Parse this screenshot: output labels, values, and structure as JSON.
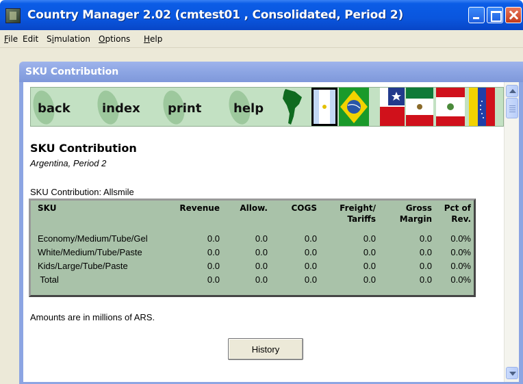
{
  "window": {
    "title": "Country Manager 2.02 (cmtest01 , Consolidated, Period 2)",
    "icons": {
      "app": "app-icon",
      "minimize": "minimize-icon",
      "maximize": "maximize-icon",
      "close": "close-icon"
    }
  },
  "menu": {
    "items": [
      {
        "mnemonic": "F",
        "rest": "ile"
      },
      {
        "mnemonic": "",
        "rest": "Edit"
      },
      {
        "pre": "S",
        "mnemonic": "i",
        "rest": "mulation"
      },
      {
        "mnemonic": "O",
        "rest": "ptions"
      },
      {
        "mnemonic": "H",
        "rest": "elp"
      }
    ]
  },
  "inner_window": {
    "title": "SKU Contribution"
  },
  "nav": {
    "buttons": [
      "back",
      "index",
      "print",
      "help"
    ],
    "flags": [
      "south-america-map-icon",
      "argentina-flag-icon",
      "brazil-flag-icon",
      "chile-flag-icon",
      "mexico-flag-icon",
      "peru-flag-icon",
      "venezuela-flag-icon"
    ]
  },
  "page": {
    "title": "SKU Contribution",
    "subtitle": "Argentina, Period 2",
    "table_caption": "SKU Contribution: Allsmile",
    "footnote": "Amounts are in millions of ARS.",
    "history_label": "History"
  },
  "table": {
    "headers": [
      {
        "l1": "SKU",
        "l2": ""
      },
      {
        "l1": "Revenue",
        "l2": ""
      },
      {
        "l1": "Allow.",
        "l2": ""
      },
      {
        "l1": "COGS",
        "l2": ""
      },
      {
        "l1": "Freight/",
        "l2": "Tariffs"
      },
      {
        "l1": "Gross",
        "l2": "Margin"
      },
      {
        "l1": "Pct of",
        "l2": "Rev."
      }
    ],
    "rows": [
      [
        "Economy/Medium/Tube/Gel",
        "0.0",
        "0.0",
        "0.0",
        "0.0",
        "0.0",
        "0.0%"
      ],
      [
        "White/Medium/Tube/Paste",
        "0.0",
        "0.0",
        "0.0",
        "0.0",
        "0.0",
        "0.0%"
      ],
      [
        "Kids/Large/Tube/Paste",
        "0.0",
        "0.0",
        "0.0",
        "0.0",
        "0.0",
        "0.0%"
      ],
      [
        " Total",
        "0.0",
        "0.0",
        "0.0",
        "0.0",
        "0.0",
        "0.0%"
      ]
    ]
  }
}
